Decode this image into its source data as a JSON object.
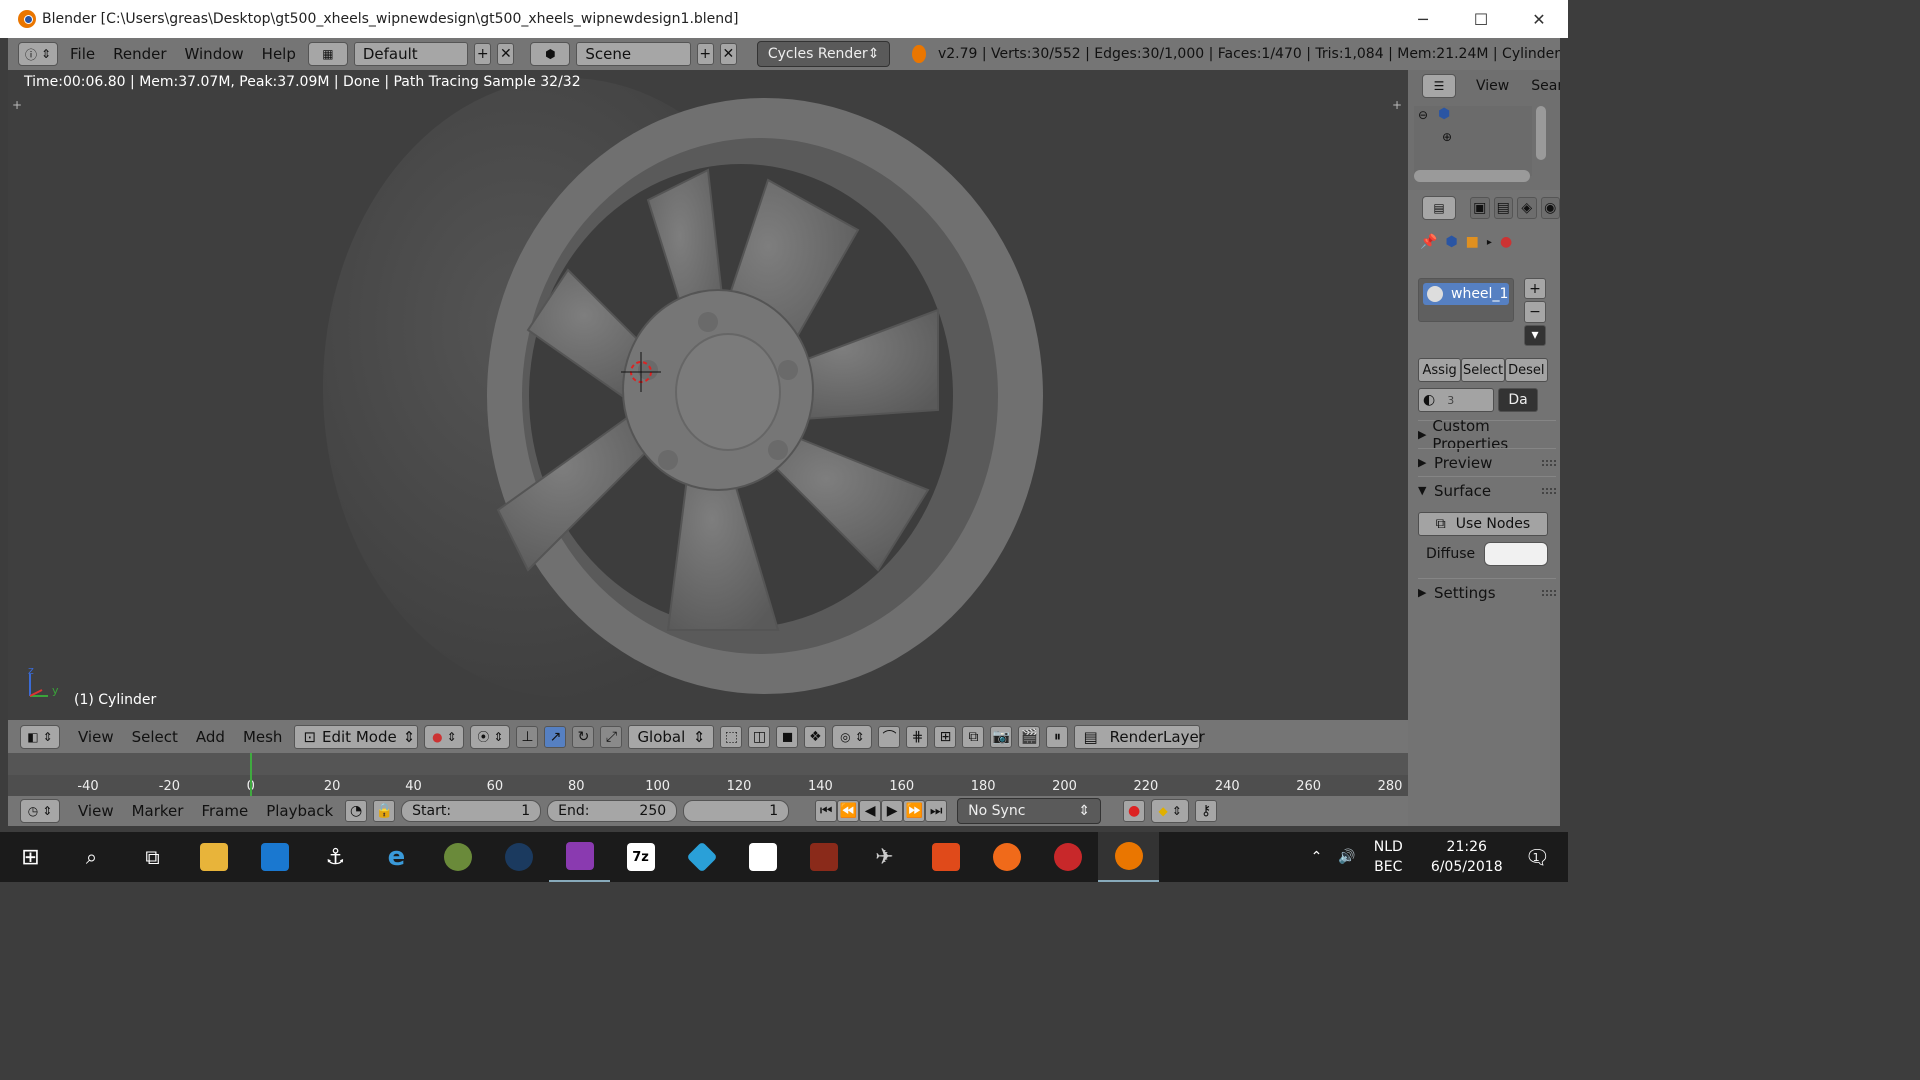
{
  "window": {
    "title": "Blender [C:\\Users\\greas\\Desktop\\gt500_xheels_wipnewdesign\\gt500_xheels_wipnewdesign1.blend]",
    "minimize": "─",
    "maximize": "☐",
    "close": "✕"
  },
  "info_header": {
    "menus": [
      "File",
      "Render",
      "Window",
      "Help"
    ],
    "screen_layout": "Default",
    "scene": "Scene",
    "render_engine": "Cycles Render",
    "stats": "v2.79 | Verts:30/552 | Edges:30/1,000 | Faces:1/470 | Tris:1,084 | Mem:21.24M | Cylinder"
  },
  "viewport": {
    "render_status": "Time:00:06.80 | Mem:37.07M, Peak:37.09M | Done | Path Tracing Sample 32/32",
    "object_label": "(1) Cylinder",
    "axis_z": "z",
    "axis_y": "y"
  },
  "outliner": {
    "view": "View",
    "search": "Search"
  },
  "properties": {
    "material_name": "wheel_1",
    "slot_count": "3",
    "assign": "Assig",
    "select": "Select",
    "deselect": "Desel",
    "data_label": "Da",
    "panels": {
      "custom_properties": "Custom Properties",
      "preview": "Preview",
      "surface": "Surface",
      "settings": "Settings"
    },
    "use_nodes": "Use Nodes",
    "diffuse": "Diffuse",
    "diffuse_color": "#f1f1f1"
  },
  "view3d_header": {
    "menus": [
      "View",
      "Select",
      "Add",
      "Mesh"
    ],
    "mode": "Edit Mode",
    "orientation": "Global",
    "render_layer": "RenderLayer"
  },
  "timeline": {
    "ticks": [
      "-40",
      "-20",
      "0",
      "20",
      "40",
      "60",
      "80",
      "100",
      "120",
      "140",
      "160",
      "180",
      "200",
      "220",
      "240",
      "260",
      "280"
    ],
    "current_frame_marker": 1
  },
  "timeline_header": {
    "menus": [
      "View",
      "Marker",
      "Frame",
      "Playback"
    ],
    "start_label": "Start:",
    "start": "1",
    "end_label": "End:",
    "end": "250",
    "current_frame": "1",
    "sync": "No Sync"
  },
  "taskbar": {
    "lang": "NLD",
    "layout": "BEC",
    "time": "21:26",
    "date": "6/05/2018",
    "notifications": "1",
    "apps": [
      "start",
      "search",
      "task-view",
      "file-explorer",
      "store",
      "corsair",
      "internet-explorer",
      "app-green",
      "steam",
      "winrar",
      "7zip",
      "kodi",
      "epic",
      "max-payne",
      "aorus",
      "office",
      "origin",
      "ccleaner",
      "blender"
    ]
  },
  "colors": {
    "accent": "#ea7600",
    "header_gray": "#757575",
    "viewport_bg": "#3f3f3f",
    "selection_blue": "#5680c2"
  }
}
